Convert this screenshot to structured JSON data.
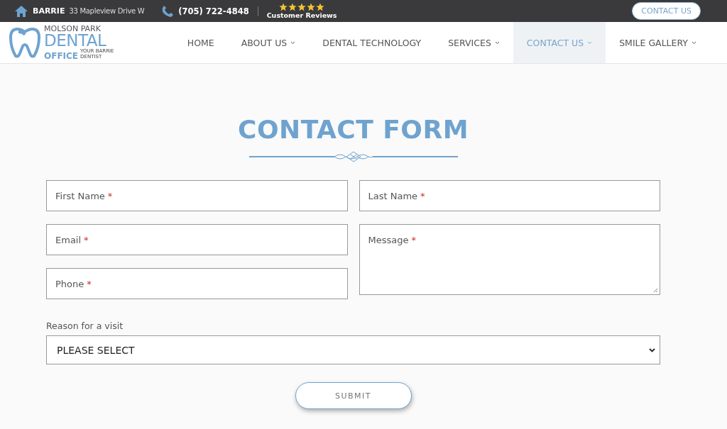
{
  "top_bar": {
    "city": "BARRIE",
    "address": "33 Mapleview Drive W",
    "phone": "(705) 722-4848",
    "stars": 5,
    "reviews_label": "Customer Reviews",
    "contact_button": "CONTACT US"
  },
  "logo": {
    "line_1": "MOLSON PARK",
    "line_2": "DENTAL",
    "line_3": "OFFICE",
    "tagline": "YOUR BARRIE DENTIST"
  },
  "nav": [
    {
      "label": "HOME",
      "dropdown": false,
      "selected": false
    },
    {
      "label": "ABOUT US",
      "dropdown": true,
      "selected": false
    },
    {
      "label": "DENTAL TECHNOLOGY",
      "dropdown": false,
      "selected": false
    },
    {
      "label": "SERVICES",
      "dropdown": true,
      "selected": false
    },
    {
      "label": "CONTACT US",
      "dropdown": true,
      "selected": true
    },
    {
      "label": "SMILE GALLERY",
      "dropdown": true,
      "selected": false
    }
  ],
  "form": {
    "title": "CONTACT FORM",
    "left_fields": [
      {
        "placeholder": "First Name",
        "required_mark": "*"
      },
      {
        "placeholder": "Email",
        "required_mark": "*"
      },
      {
        "placeholder": "Phone",
        "required_mark": "*"
      }
    ],
    "right_fields": [
      {
        "placeholder": "Last Name",
        "required_mark": "*",
        "kind": "input"
      },
      {
        "placeholder": "Message",
        "required_mark": "*",
        "kind": "textarea"
      }
    ],
    "reason_label": "Reason for a visit",
    "reason_value": "PLEASE SELECT",
    "submit": "SUBMIT"
  }
}
